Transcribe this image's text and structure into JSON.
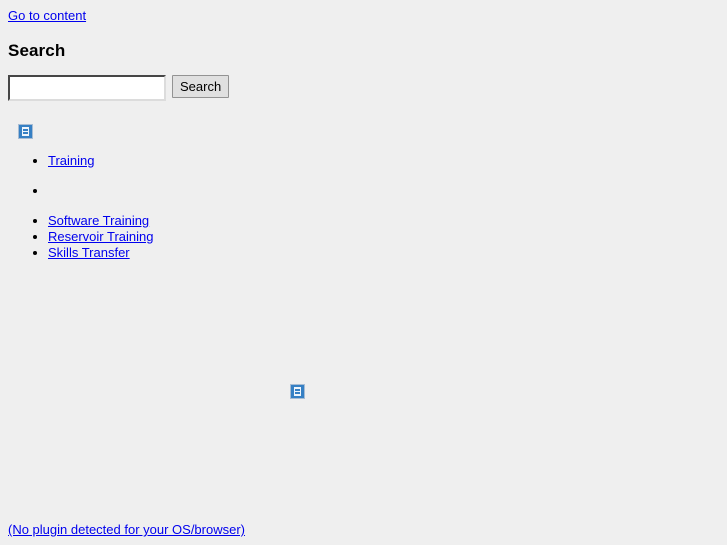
{
  "page": {
    "background_color": "#efefef",
    "link_color": "#0000ee",
    "text_color": "#000000"
  },
  "skip": {
    "label": "Go to content"
  },
  "heading": {
    "title": "Search"
  },
  "search": {
    "value": "",
    "placeholder": "",
    "button_label": "Search"
  },
  "images": {
    "top_alt": "",
    "center_alt": ""
  },
  "nav": {
    "items": [
      {
        "label": "Training"
      },
      {
        "label": " "
      },
      {
        "label": " Software Training "
      },
      {
        "label": " Reservoir Training "
      },
      {
        "label": " Skills Transfer "
      }
    ]
  },
  "footer": {
    "plugin_note": "(No plugin detected for your OS/browser)"
  }
}
